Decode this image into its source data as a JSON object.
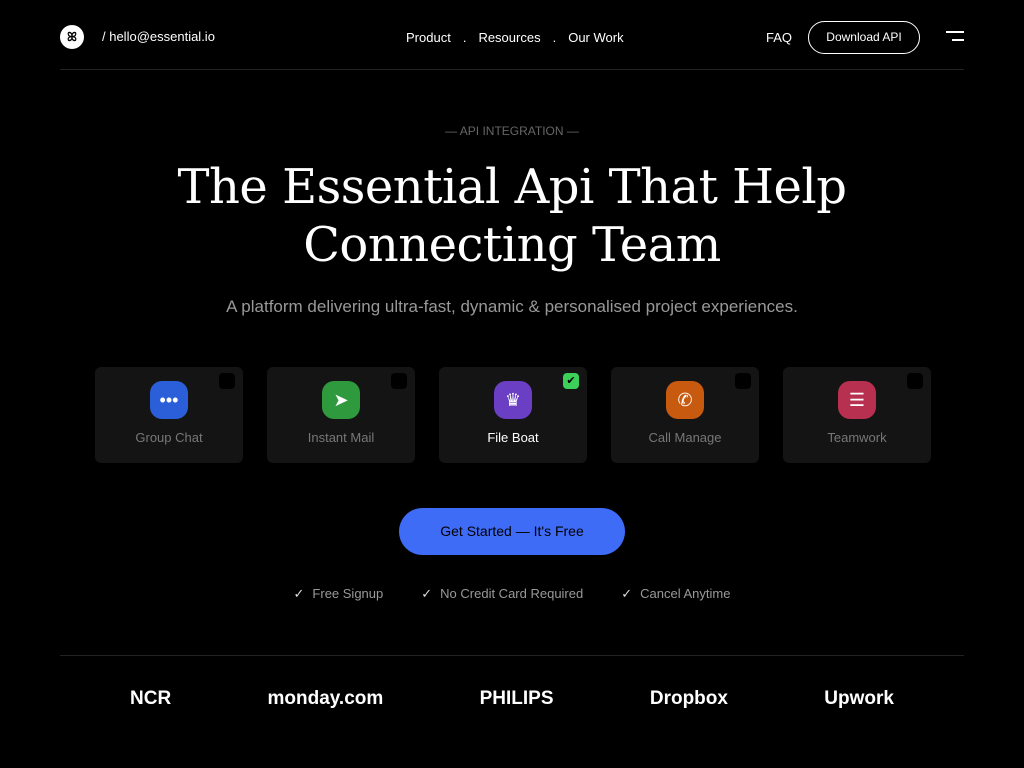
{
  "header": {
    "logo_glyph": "ꕤ",
    "email": "/ hello@essential.io",
    "nav": [
      "Product",
      "Resources",
      "Our Work"
    ],
    "faq": "FAQ",
    "download": "Download API"
  },
  "hero": {
    "eyebrow": "— API INTEGRATION —",
    "title_line1": "The Essential Api That Help",
    "title_line2": "Connecting Team",
    "subtitle": "A platform delivering ultra-fast, dynamic & personalised project experiences."
  },
  "cards": [
    {
      "label": "Group Chat",
      "icon": "chat-bubble-icon",
      "color": "#2b5fd9",
      "selected": false
    },
    {
      "label": "Instant Mail",
      "icon": "paper-plane-icon",
      "color": "#2f9a3d",
      "selected": false
    },
    {
      "label": "File Boat",
      "icon": "crown-icon",
      "color": "#6a3fc4",
      "selected": true
    },
    {
      "label": "Call Manage",
      "icon": "phone-icon",
      "color": "#c85a10",
      "selected": false
    },
    {
      "label": "Teamwork",
      "icon": "message-icon",
      "color": "#b8304f",
      "selected": false
    }
  ],
  "cta": "Get Started — It's Free",
  "features": [
    "Free Signup",
    "No Credit Card Required",
    "Cancel Anytime"
  ],
  "logos": [
    "NCR",
    "monday.com",
    "PHILIPS",
    "Dropbox",
    "Upwork"
  ]
}
